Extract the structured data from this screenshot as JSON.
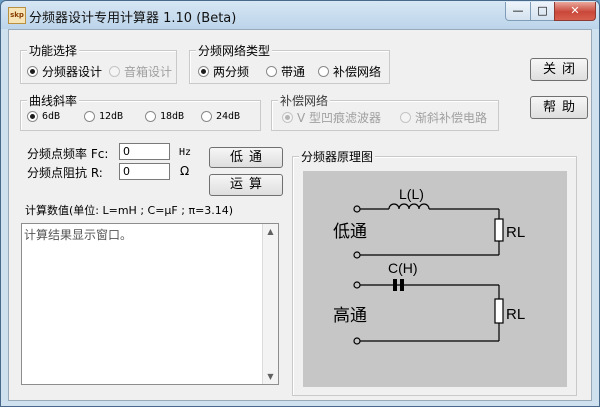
{
  "window": {
    "title": "分频器设计专用计算器 1.10 (Beta)",
    "icon_text": "skp",
    "minimize_glyph": "—",
    "maximize_glyph": "□",
    "close_glyph": "✕"
  },
  "function_group": {
    "title": "功能选择",
    "options": [
      {
        "label": "分频器设计",
        "selected": true,
        "enabled": true
      },
      {
        "label": "音箱设计",
        "selected": false,
        "enabled": false
      }
    ]
  },
  "network_group": {
    "title": "分频网络类型",
    "options": [
      {
        "label": "两分频",
        "selected": true
      },
      {
        "label": "带通",
        "selected": false
      },
      {
        "label": "补偿网络",
        "selected": false
      }
    ]
  },
  "slope_group": {
    "title": "曲线斜率",
    "options": [
      {
        "label": "6dB",
        "selected": true
      },
      {
        "label": "12dB",
        "selected": false
      },
      {
        "label": "18dB",
        "selected": false
      },
      {
        "label": "24dB",
        "selected": false
      }
    ]
  },
  "compensation_group": {
    "title": "补偿网络",
    "options": [
      {
        "label": "V 型凹痕滤波器",
        "selected": true,
        "enabled": false
      },
      {
        "label": "渐斜补偿电路",
        "selected": false,
        "enabled": false
      }
    ]
  },
  "buttons": {
    "close": "关闭",
    "help": "帮助",
    "lowpass": "低通",
    "calculate": "运算"
  },
  "inputs": {
    "freq_label": "分频点频率 Fc:",
    "freq_value": "0",
    "freq_unit": "Hz",
    "imp_label": "分频点阻抗 R:",
    "imp_value": "0",
    "imp_unit": "Ω"
  },
  "results": {
    "caption": "计算数值(单位: L=mH ; C=μF ; π=3.14)",
    "text": "计算结果显示窗口。"
  },
  "schematic": {
    "title": "分频器原理图",
    "inductor_label": "L(L)",
    "capacitor_label": "C(H)",
    "lowpass_label": "低通",
    "highpass_label": "高通",
    "load_label_1": "RL",
    "load_label_2": "RL",
    "background": "#c6c6c6"
  }
}
